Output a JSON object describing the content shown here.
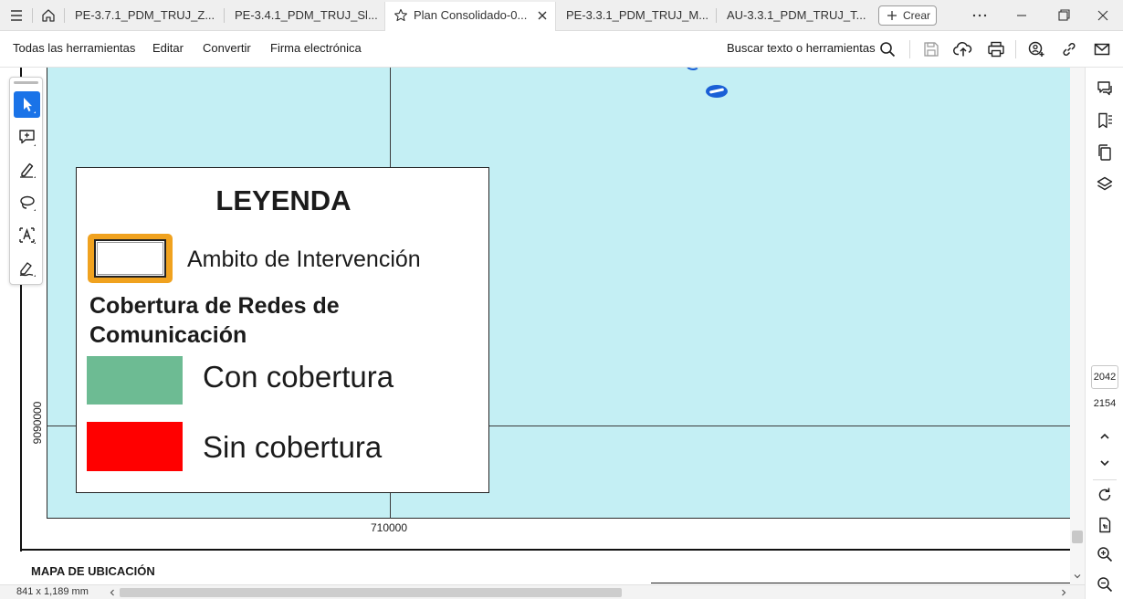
{
  "tabs": [
    {
      "label": "PE-3.7.1_PDM_TRUJ_Z..."
    },
    {
      "label": "PE-3.4.1_PDM_TRUJ_Sl..."
    },
    {
      "label": "Plan Consolidado-0..."
    },
    {
      "label": "PE-3.3.1_PDM_TRUJ_M..."
    },
    {
      "label": "AU-3.3.1_PDM_TRUJ_T..."
    }
  ],
  "create_button": {
    "label": "Crear"
  },
  "menu": {
    "items": [
      "Todas las herramientas",
      "Editar",
      "Convertir",
      "Firma electrónica"
    ],
    "search_label": "Buscar texto o herramientas"
  },
  "map": {
    "y_coord": "9090000",
    "x_coord": "710000",
    "location_title": "MAPA DE UBICACIÓN",
    "background_color": "#c4eff4"
  },
  "legend": {
    "title": "LEYENDA",
    "ambito_label": "Ambito de Intervención",
    "section_title_line1": "Cobertura de Redes de",
    "section_title_line2": "Comunicación",
    "con_label": "Con cobertura",
    "sin_label": "Sin cobertura",
    "con_color": "#6dbb93",
    "sin_color": "#ff0000",
    "ambito_color": "#f0a21f"
  },
  "page_nav": {
    "current": "2042",
    "total": "2154"
  },
  "status": {
    "page_size": "841 x 1,189 mm"
  },
  "icons": [
    "home-icon",
    "star-icon",
    "close-icon",
    "search-icon",
    "save-icon",
    "upload-icon",
    "print-icon",
    "share-user-icon",
    "link-icon",
    "mail-icon",
    "cursor-icon",
    "comment-icon",
    "highlight-icon",
    "lasso-icon",
    "text-select-icon",
    "sign-icon",
    "comments-panel-icon",
    "bookmark-icon",
    "pages-icon",
    "layers-icon",
    "chevron-up-icon",
    "chevron-down-icon",
    "rotate-icon",
    "page-fit-icon",
    "zoom-in-icon",
    "zoom-out-icon"
  ]
}
